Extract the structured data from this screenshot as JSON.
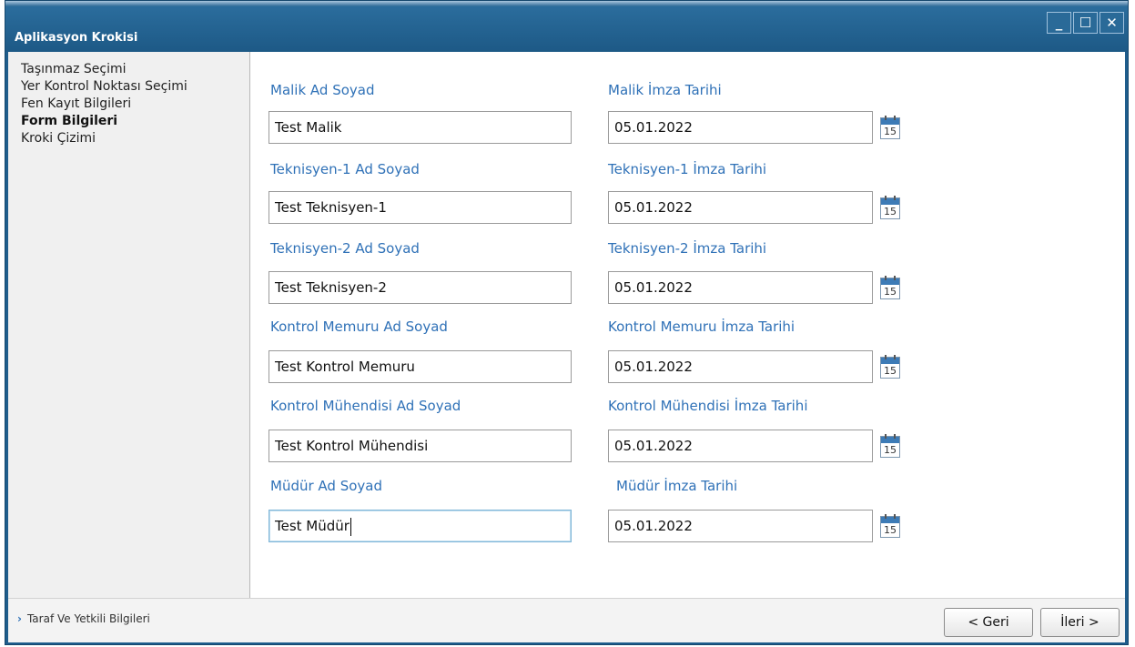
{
  "window": {
    "title": "Aplikasyon Krokisi",
    "buttons": {
      "minimize": "_",
      "maximize": "☐",
      "close": "✕"
    }
  },
  "sidebar": {
    "items": [
      {
        "label": "Taşınmaz Seçimi",
        "active": false
      },
      {
        "label": "Yer Kontrol Noktası Seçimi",
        "active": false
      },
      {
        "label": "Fen Kayıt Bilgileri",
        "active": false
      },
      {
        "label": "Form Bilgileri",
        "active": true
      },
      {
        "label": "Kroki Çizimi",
        "active": false
      }
    ]
  },
  "form": {
    "rows": [
      {
        "name_label": "Malik Ad Soyad",
        "name_value": "Test Malik",
        "date_label": "Malik İmza Tarihi",
        "date_value": "05.01.2022"
      },
      {
        "name_label": "Teknisyen-1 Ad Soyad",
        "name_value": "Test Teknisyen-1",
        "date_label": "Teknisyen-1 İmza Tarihi",
        "date_value": "05.01.2022"
      },
      {
        "name_label": "Teknisyen-2 Ad Soyad",
        "name_value": "Test Teknisyen-2",
        "date_label": "Teknisyen-2 İmza Tarihi",
        "date_value": "05.01.2022"
      },
      {
        "name_label": "Kontrol Memuru Ad Soyad",
        "name_value": "Test Kontrol Memuru",
        "date_label": "Kontrol Memuru İmza Tarihi",
        "date_value": "05.01.2022"
      },
      {
        "name_label": "Kontrol Mühendisi Ad Soyad",
        "name_value": "Test Kontrol Mühendisi",
        "date_label": "Kontrol Mühendisi İmza Tarihi",
        "date_value": "05.01.2022"
      },
      {
        "name_label": "Müdür Ad Soyad",
        "name_value": "Test Müdür",
        "date_label": "Müdür İmza Tarihi",
        "date_value": "05.01.2022"
      }
    ],
    "calendar_icon_number": "15"
  },
  "footer": {
    "link_label": "Taraf Ve Yetkili Bilgileri",
    "back_label": "< Geri",
    "next_label": "İleri >"
  }
}
